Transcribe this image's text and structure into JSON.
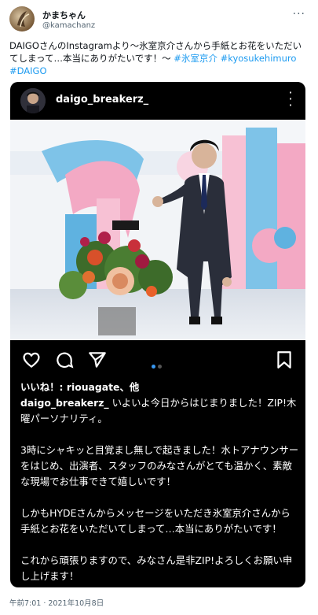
{
  "tweet": {
    "display_name": "かまちゃん",
    "handle": "@kamachanz",
    "text_part1": "DAIGOさんのInstagramより～氷室京介さんから手紙とお花をいただいてしまって…本当にありがたいです！～ ",
    "hashtag1": "#氷室京介",
    "hashtag2": "#kyosukehimuro",
    "hashtag3": "#DAIGO",
    "timestamp": "午前7:01 · 2021年10月8日"
  },
  "instagram": {
    "username": "daigo_breakerz_",
    "likes": "いいね！: riouagate、他",
    "caption_user": "daigo_breakerz_",
    "caption_p1": "いよいよ今日からはじまりました！ZIP!木曜パーソナリティ。",
    "caption_p2": "3時にシャキッと目覚まし無しで起きました！水トアナウンサーをはじめ、出演者、スタッフのみなさんがとても温かく、素敵な現場でお仕事できて嬉しいです！",
    "caption_p3": "しかもHYDEさんからメッセージをいただき氷室京介さんから手紙とお花をいただいてしまって…本当にありがたいです！",
    "caption_p4": "これから頑張りますので、みなさん是非ZIP!よろしくお願い申し上げます！"
  },
  "icons": {
    "more": "more-horizontal-icon",
    "ig_more": "more-vertical-icon",
    "like": "heart-icon",
    "comment": "comment-icon",
    "share": "send-icon",
    "save": "bookmark-icon"
  },
  "colors": {
    "link": "#1d9bf0",
    "card_bg": "#000000",
    "carousel_active": "#3897f0"
  }
}
